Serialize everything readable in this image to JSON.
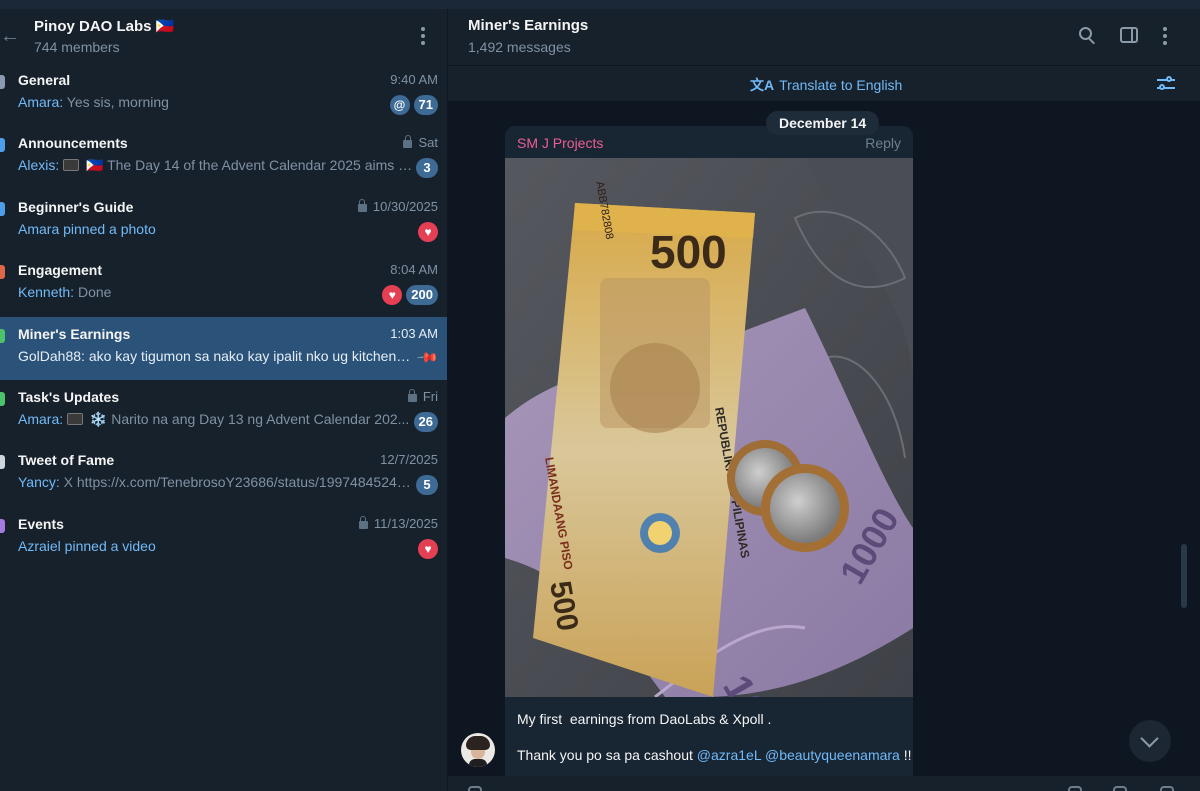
{
  "group": {
    "title": "Pinoy DAO Labs 🇵🇭",
    "members": "744 members"
  },
  "topics": [
    {
      "name": "General",
      "time": "9:40 AM",
      "sender": "Amara:",
      "preview": " Yes sis, morning",
      "unread": "71",
      "mention": "@",
      "icon_color": "#8a9bb0"
    },
    {
      "name": "Announcements",
      "time": "Sat",
      "sender": "Alexis:",
      "preview": " 🇵🇭 The Day 14 of the Advent Calendar 2025 aims fo...",
      "unread": "3",
      "icon_color": "#4f9fe8"
    },
    {
      "name": "Beginner's Guide",
      "time": "10/30/2025",
      "preview": "Amara pinned a photo",
      "icon_color": "#4f9fe8"
    },
    {
      "name": "Engagement",
      "time": "8:04 AM",
      "sender": "Kenneth:",
      "preview": " Done",
      "unread": "200",
      "icon_color": "#e0664a"
    },
    {
      "name": "Miner's Earnings",
      "time": "1:03 AM",
      "sender": "GolDah88:",
      "preview": " ako kay tigumon sa nako kay ipalit nko ug kitchen c...",
      "icon_color": "#4cc26a"
    },
    {
      "name": "Task's Updates",
      "time": "Fri",
      "sender": "Amara:",
      "preview": " ❄️ Narito na ang Day 13 ng Advent Calendar 202...",
      "unread": "26",
      "icon_color": "#4cc26a"
    },
    {
      "name": "Tweet of Fame",
      "time": "12/7/2025",
      "sender": "Yancy:",
      "preview": " X https://x.com/TenebrosoY23686/status/19974845244...",
      "unread": "5",
      "icon_color": "#cfd6de"
    },
    {
      "name": "Events",
      "time": "11/13/2025",
      "preview": "Azraiel pinned a video",
      "icon_color": "#a37be0"
    }
  ],
  "chat": {
    "title": "Miner's Earnings",
    "subtitle": "1,492 messages",
    "translate_label": "Translate to English",
    "date": "December 14",
    "message": {
      "author": "SM J Projects",
      "reply_label": "Reply",
      "line1": "My first  earnings from DaoLabs & Xpoll .",
      "line2_prefix": "Thank you po sa pa cashout ",
      "mention1": "@azra1eL",
      "mention2": "@beautyqueenamara",
      "line2_suffix": " !!",
      "banknote_value": "500",
      "banknote_text": "REPUBLIKA NG PILIPINAS",
      "banknote_unit": "LIMANDAANG PISO",
      "serial": "ABB782808"
    }
  },
  "colors": {
    "sidebar_bg": "#17212b",
    "chat_bg": "#0e1621",
    "active_topic": "#2b5278",
    "accent_link": "#71baf8",
    "badge": "#3e6a96",
    "heart_badge": "#e53f54",
    "author_pink": "#ee5d94"
  }
}
